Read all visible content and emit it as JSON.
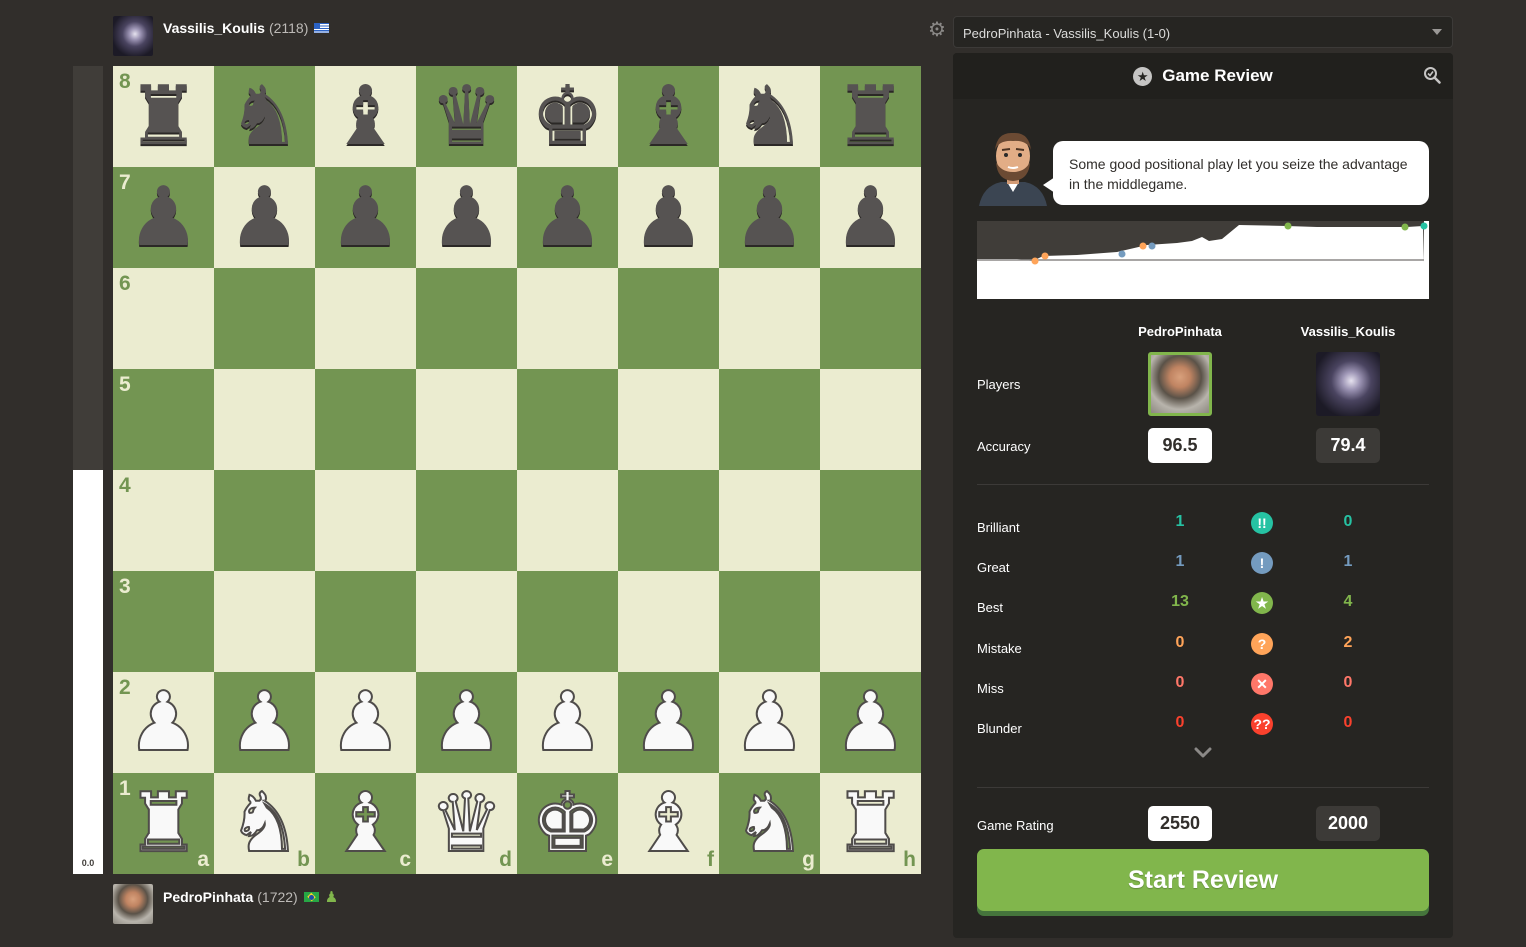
{
  "top_player": {
    "name": "Vassilis_Koulis",
    "rating": "(2118)",
    "flag": "greece-flag"
  },
  "bottom_player": {
    "name": "PedroPinhata",
    "rating": "(1722)",
    "flag": "brazil-flag",
    "badge": "pawn-icon"
  },
  "eval_bar": {
    "value": "0.0",
    "white_fraction": 0.5
  },
  "board": {
    "ranks": [
      "8",
      "7",
      "6",
      "5",
      "4",
      "3",
      "2",
      "1"
    ],
    "files": [
      "a",
      "b",
      "c",
      "d",
      "e",
      "f",
      "g",
      "h"
    ],
    "position": [
      [
        "♜",
        "♞",
        "♝",
        "♛",
        "♚",
        "♝",
        "♞",
        "♜"
      ],
      [
        "♟",
        "♟",
        "♟",
        "♟",
        "♟",
        "♟",
        "♟",
        "♟"
      ],
      [
        "",
        "",
        "",
        "",
        "",
        "",
        "",
        ""
      ],
      [
        "",
        "",
        "",
        "",
        "",
        "",
        "",
        ""
      ],
      [
        "",
        "",
        "",
        "",
        "",
        "",
        "",
        ""
      ],
      [
        "",
        "",
        "",
        "",
        "",
        "",
        "",
        ""
      ],
      [
        "♙",
        "♙",
        "♙",
        "♙",
        "♙",
        "♙",
        "♙",
        "♙"
      ],
      [
        "♖",
        "♘",
        "♗",
        "♕",
        "♔",
        "♗",
        "♘",
        "♖"
      ]
    ]
  },
  "game_select": {
    "value": "PedroPinhata - Vassilis_Koulis (1-0)"
  },
  "review": {
    "title": "Game Review",
    "coach_message": "Some good positional play let you seize the advantage in the middlegame.",
    "white_name": "PedroPinhata",
    "black_name": "Vassilis_Koulis",
    "players_label": "Players",
    "accuracy_label": "Accuracy",
    "white_accuracy": "96.5",
    "black_accuracy": "79.4",
    "classifications": [
      {
        "label": "Brilliant",
        "white": "1",
        "black": "0",
        "color": "#26c2a3",
        "symbol": "!!"
      },
      {
        "label": "Great",
        "white": "1",
        "black": "1",
        "color": "#749bbf",
        "symbol": "!"
      },
      {
        "label": "Best",
        "white": "13",
        "black": "4",
        "color": "#81b64c",
        "symbol": "★"
      },
      {
        "label": "Mistake",
        "white": "0",
        "black": "2",
        "color": "#ffa459",
        "symbol": "?"
      },
      {
        "label": "Miss",
        "white": "0",
        "black": "0",
        "color": "#ff7769",
        "symbol": "✕"
      },
      {
        "label": "Blunder",
        "white": "0",
        "black": "0",
        "color": "#fa412d",
        "symbol": "??"
      }
    ],
    "game_rating_label": "Game Rating",
    "white_game_rating": "2550",
    "black_game_rating": "2000",
    "start_button": "Start Review"
  }
}
